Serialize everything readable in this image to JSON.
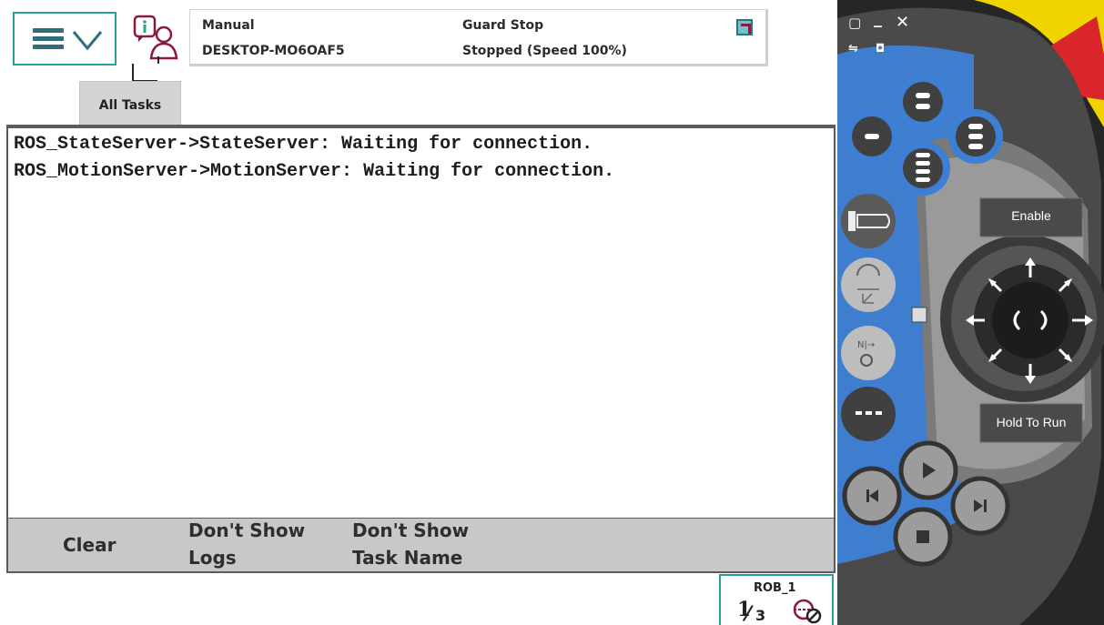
{
  "header": {
    "menu_icon": "hamburger-menu-icon",
    "info_icon": "event-log-info-icon",
    "mode": "Manual",
    "controller": "DESKTOP-MO6OAF5",
    "state": "Guard Stop",
    "run_state": "Stopped (Speed 100%)",
    "status_icon": "quickset-icon"
  },
  "tabs": [
    {
      "label": "All Tasks"
    }
  ],
  "log": {
    "lines": [
      "ROS_StateServer->StateServer: Waiting for connection.",
      "ROS_MotionServer->MotionServer: Waiting for connection."
    ]
  },
  "commands": {
    "clear": "Clear",
    "logs_l1": "Don't Show",
    "logs_l2": "Logs",
    "task_l1": "Don't Show",
    "task_l2": "Task Name"
  },
  "taskbar": {
    "robot": "ROB_1",
    "fraction_num": "1",
    "fraction_den": "3"
  },
  "pendant": {
    "enable_label": "Enable",
    "hold_label": "Hold To Run",
    "accent": "#3e7fd6",
    "body": "#4a4a4a",
    "estop": "#d8262a",
    "guard": "#f0d400"
  },
  "colors": {
    "accent_teal": "#2a9d9d",
    "command_bar": "#c8c8c8"
  }
}
